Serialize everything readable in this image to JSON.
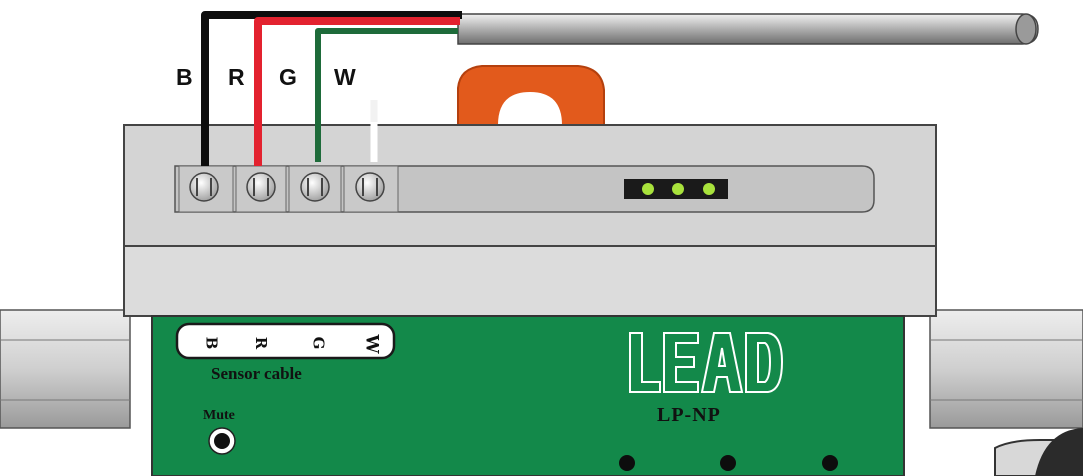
{
  "wire_labels": {
    "black": "B",
    "red": "R",
    "green": "G",
    "white": "W"
  },
  "terminal_strip_labels": {
    "b": "B",
    "r": "R",
    "g": "G",
    "w": "W"
  },
  "sensor_cable_label": "Sensor cable",
  "mute_label": "Mute",
  "brand_logo_text": "LEAD",
  "model_label": "LP-NP",
  "colors": {
    "wire_black": "#0d0d0d",
    "wire_red": "#e3222f",
    "wire_green": "#1e6b3a",
    "wire_white": "#ffffff",
    "board_green": "#13894a",
    "housing_gray": "#d4d4d4",
    "clip_orange": "#e25a1c",
    "led_green": "#a8e23c"
  }
}
